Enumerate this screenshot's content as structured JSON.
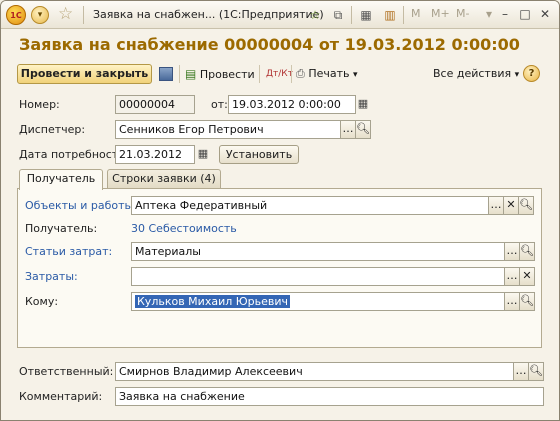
{
  "titlebar": {
    "logo_text": "1С",
    "window_title": "Заявка на снабжен...  (1С:Предприятие)",
    "m_labels": [
      "M",
      "M+",
      "M-"
    ]
  },
  "header": {
    "title": "Заявка на снабжение 00000004 от 19.03.2012 0:00:00"
  },
  "toolbar": {
    "post_close_label": "Провести и закрыть",
    "post_label": "Провести",
    "print_label": "Печать",
    "all_actions_label": "Все действия",
    "help_label": "?"
  },
  "form": {
    "number_label": "Номер:",
    "number_value": "00000004",
    "from_label": "от:",
    "date_value": "19.03.2012  0:00:00",
    "dispatcher_label": "Диспетчер:",
    "dispatcher_value": "Сенников Егор Петрович",
    "need_date_label": "Дата потребности:",
    "need_date_value": "21.03.2012",
    "set_button": "Установить"
  },
  "tabs": [
    {
      "label": "Получатель"
    },
    {
      "label": "Строки заявки (4)"
    }
  ],
  "recipient": {
    "objects_label": "Объекты и работы:",
    "objects_value": "Аптека Федеративный",
    "recipient_label": "Получатель:",
    "recipient_value": "30 Себестоимость",
    "cost_items_label": "Статьи затрат:",
    "cost_items_value": "Материалы",
    "costs_label": "Затраты:",
    "costs_value": "",
    "to_whom_label": "Кому:",
    "to_whom_value": "Кульков Михаил Юрьевич"
  },
  "footer": {
    "responsible_label": "Ответственный:",
    "responsible_value": "Смирнов Владимир Алексеевич",
    "comment_label": "Комментарий:",
    "comment_value": "Заявка на снабжение"
  },
  "colors": {
    "title": "#9c6a00",
    "link": "#2a5aa6",
    "selection": "#3466b5"
  }
}
